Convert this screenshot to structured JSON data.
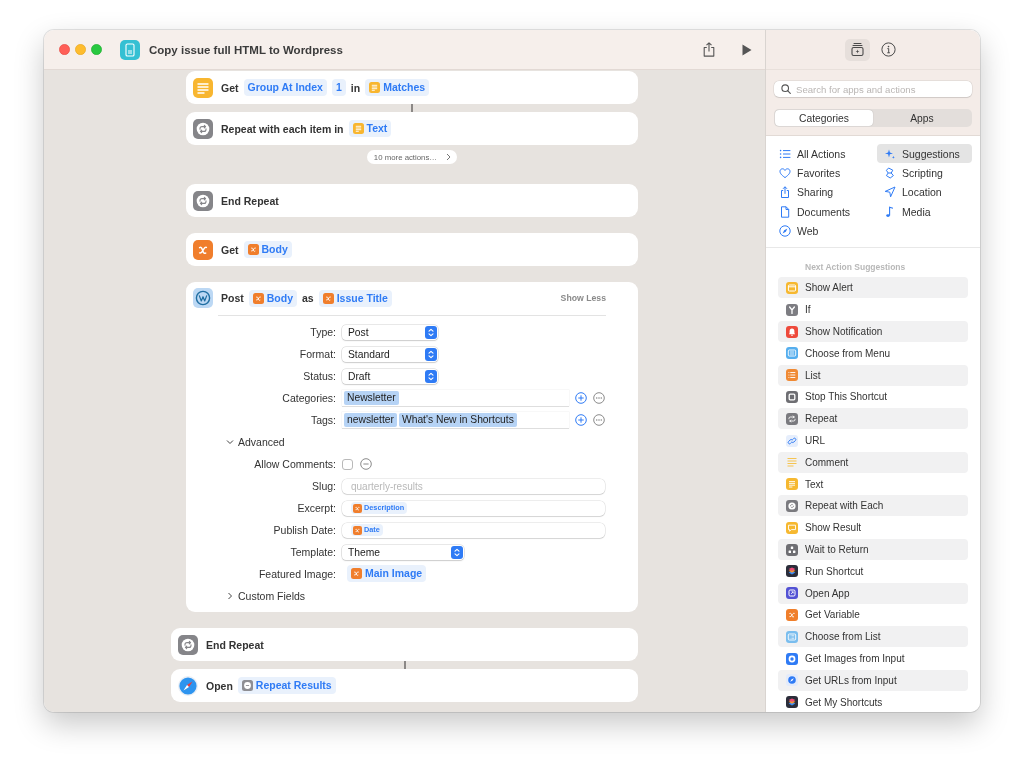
{
  "window": {
    "title": "Copy issue full HTML to Wordpress"
  },
  "actions": [
    {
      "kind": "block",
      "children": [
        {
          "kind": "text",
          "connected": false,
          "parts": [
            {
              "kind": "label",
              "text": "Get"
            },
            {
              "kind": "parameter",
              "text": "Group At Index"
            },
            {
              "kind": "parameter",
              "text": "1"
            },
            {
              "kind": "label",
              "text": "in"
            },
            {
              "kind": "text_variable",
              "text": "Matches"
            }
          ]
        },
        {
          "kind": "repeat",
          "connected": true,
          "parts": [
            {
              "kind": "label",
              "text": "Repeat with each item in"
            },
            {
              "kind": "text_variable",
              "text": "Text"
            }
          ]
        },
        {
          "kind": "more",
          "label": "10 more actions…"
        },
        {
          "kind": "repeat",
          "connected": false,
          "parts": [
            {
              "kind": "label",
              "text": "End Repeat"
            }
          ]
        },
        {
          "kind": "variable",
          "connected": false,
          "parts": [
            {
              "kind": "label",
              "text": "Get"
            },
            {
              "kind": "variable",
              "text": "Body"
            }
          ]
        },
        {
          "kind": "wordpress",
          "connected": false,
          "parts": [
            {
              "kind": "label",
              "text": "Post"
            },
            {
              "kind": "variable",
              "text": "Body"
            },
            {
              "kind": "label",
              "text": "as"
            },
            {
              "kind": "variable",
              "text": "Issue Title"
            }
          ],
          "toggle": "Show Less",
          "fields": [
            {
              "kind": "popup",
              "label": "Type:",
              "value": "Post"
            },
            {
              "kind": "popup",
              "label": "Format:",
              "value": "Standard"
            },
            {
              "kind": "popup",
              "label": "Status:",
              "value": "Draft"
            },
            {
              "kind": "tokens",
              "label": "Categories:",
              "tokens": [
                "Newsletter"
              ]
            },
            {
              "kind": "tokens",
              "label": "Tags:",
              "tokens": [
                "newsletter",
                "What's New in Shortcuts"
              ]
            }
          ],
          "sections": [
            {
              "label": "Advanced",
              "expanded": true,
              "fields": [
                {
                  "kind": "checkbox",
                  "label": "Allow Comments:",
                  "checked": false
                },
                {
                  "kind": "text",
                  "label": "Slug:",
                  "placeholder": "quarterly-results"
                },
                {
                  "kind": "variable_field",
                  "label": "Excerpt:",
                  "token": {
                    "kind": "variable",
                    "text": "Description"
                  }
                },
                {
                  "kind": "variable_field",
                  "label": "Publish Date:",
                  "token": {
                    "kind": "variable",
                    "text": "Date"
                  }
                },
                {
                  "kind": "popup",
                  "label": "Template:",
                  "value": "Theme"
                },
                {
                  "kind": "variable",
                  "label": "Featured Image:",
                  "token": {
                    "kind": "variable",
                    "text": "Main Image"
                  }
                }
              ]
            },
            {
              "label": "Custom Fields",
              "expanded": false
            }
          ]
        }
      ]
    },
    {
      "kind": "repeat",
      "connected": false,
      "parts": [
        {
          "kind": "label",
          "text": "End Repeat"
        }
      ]
    },
    {
      "kind": "web",
      "connected": true,
      "parts": [
        {
          "kind": "label",
          "text": "Open"
        },
        {
          "kind": "repeat_result",
          "text": "Repeat Results"
        }
      ]
    }
  ],
  "sidebar": {
    "panel_buttons": [
      {
        "kind": "library",
        "selected": true
      },
      {
        "kind": "info",
        "selected": false
      }
    ],
    "search": {
      "placeholder": "Search for apps and actions"
    },
    "segments": [
      {
        "label": "Categories",
        "selected": true
      },
      {
        "label": "Apps",
        "selected": false
      }
    ],
    "categories": [
      {
        "kind": "list",
        "label": "All Actions",
        "selected": false
      },
      {
        "kind": "heart",
        "label": "Favorites",
        "selected": false
      },
      {
        "kind": "share",
        "label": "Sharing",
        "selected": false
      },
      {
        "kind": "document",
        "label": "Documents",
        "selected": false
      },
      {
        "kind": "compass",
        "label": "Web",
        "selected": false
      },
      {
        "kind": "sparkle",
        "label": "Suggestions",
        "selected": true
      },
      {
        "kind": "script",
        "label": "Scripting",
        "selected": false
      },
      {
        "kind": "location",
        "label": "Location",
        "selected": false
      },
      {
        "kind": "note",
        "label": "Media",
        "selected": false
      }
    ],
    "suggestions": {
      "title": "Next Action Suggestions",
      "items": [
        {
          "kind": "alert",
          "label": "Show Alert"
        },
        {
          "kind": "if",
          "label": "If"
        },
        {
          "kind": "notification",
          "label": "Show Notification"
        },
        {
          "kind": "menu",
          "label": "Choose from Menu"
        },
        {
          "kind": "list",
          "label": "List"
        },
        {
          "kind": "stop",
          "label": "Stop This Shortcut"
        },
        {
          "kind": "repeat",
          "label": "Repeat"
        },
        {
          "kind": "url",
          "label": "URL"
        },
        {
          "kind": "comment",
          "label": "Comment"
        },
        {
          "kind": "text",
          "label": "Text"
        },
        {
          "kind": "repeat-each",
          "label": "Repeat with Each"
        },
        {
          "kind": "result",
          "label": "Show Result"
        },
        {
          "kind": "wait",
          "label": "Wait to Return"
        },
        {
          "kind": "shortcut",
          "label": "Run Shortcut"
        },
        {
          "kind": "app",
          "label": "Open App"
        },
        {
          "kind": "variable",
          "label": "Get Variable"
        },
        {
          "kind": "choose-list",
          "label": "Choose from List"
        },
        {
          "kind": "images",
          "label": "Get Images from Input"
        },
        {
          "kind": "urls",
          "label": "Get URLs from Input"
        },
        {
          "kind": "shortcut",
          "label": "Get My Shortcuts"
        }
      ]
    }
  }
}
